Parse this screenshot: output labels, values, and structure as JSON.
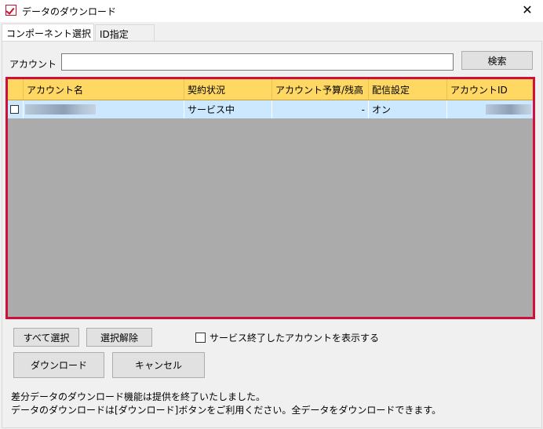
{
  "window": {
    "title": "データのダウンロード",
    "close_glyph": "✕"
  },
  "tabs": [
    {
      "label": "コンポーネント選択",
      "active": true
    },
    {
      "label": "ID指定",
      "active": false
    }
  ],
  "search": {
    "label": "アカウント",
    "value": "",
    "button_label": "検索"
  },
  "grid": {
    "columns": [
      "アカウント名",
      "契約状況",
      "アカウント予算/残高",
      "配信設定",
      "アカウントID"
    ],
    "rows": [
      {
        "checked": false,
        "account_name": "",
        "status": "サービス中",
        "budget": "-",
        "delivery": "オン",
        "account_id": ""
      }
    ]
  },
  "buttons": {
    "select_all": "すべて選択",
    "deselect": "選択解除",
    "download": "ダウンロード",
    "cancel": "キャンセル"
  },
  "show_ended": {
    "label": "サービス終了したアカウントを表示する",
    "checked": false
  },
  "notice": {
    "line1": "差分データのダウンロード機能は提供を終了いたしました。",
    "line2": "データのダウンロードは[ダウンロード]ボタンをご利用ください。全データをダウンロードできます。"
  },
  "colors": {
    "header_bg": "#ffd863",
    "selected_row_bg": "#cce8ff",
    "highlight_border": "#d0103a",
    "grid_empty_bg": "#ababab"
  }
}
